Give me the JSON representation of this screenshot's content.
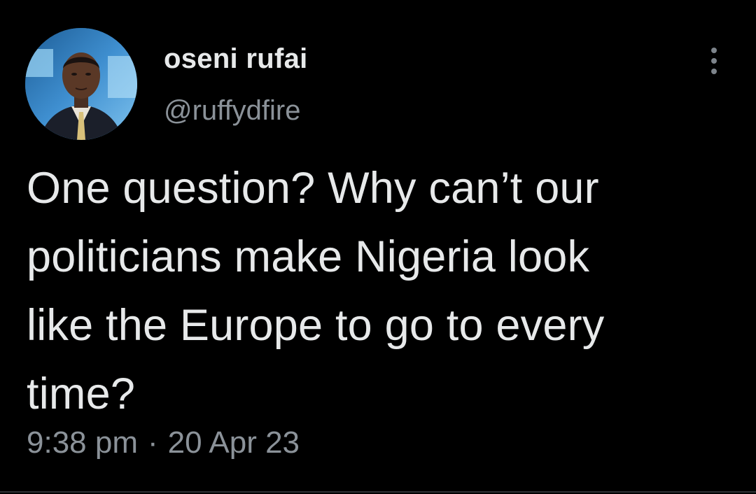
{
  "tweet": {
    "author": {
      "display_name": "oseni rufai",
      "handle": "@ruffydfire",
      "avatar_icon": "profile-photo"
    },
    "more_icon": "more-vertical-icon",
    "text_lines": [
      "One question? Why can’t our",
      "politicians make Nigeria look",
      "like the Europe to go to every",
      "time?"
    ],
    "time": "9:38 pm",
    "separator": "·",
    "date": "20 Apr 23"
  },
  "colors": {
    "background": "#000000",
    "primary_text": "#e7e9ea",
    "secondary_text": "#8b9299"
  }
}
